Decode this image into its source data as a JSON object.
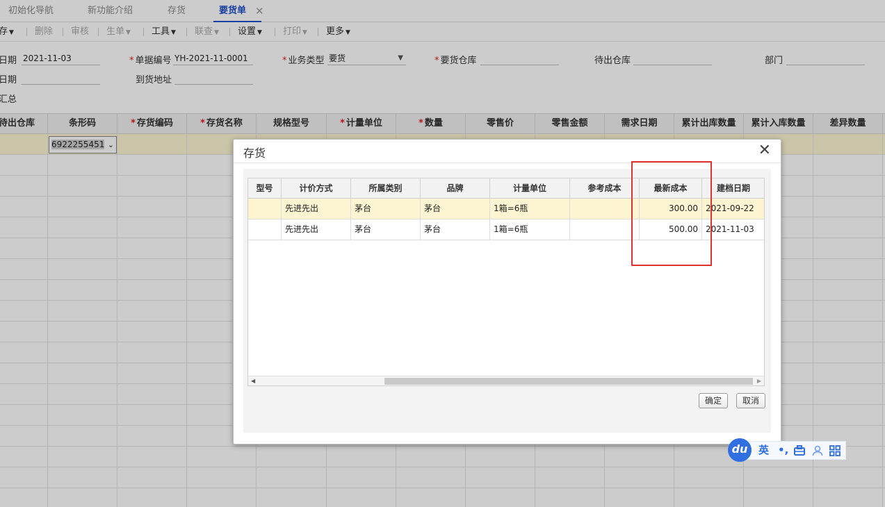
{
  "tabs": [
    {
      "label": "初始化导航",
      "active": false
    },
    {
      "label": "新功能介绍",
      "active": false
    },
    {
      "label": "存货",
      "active": false
    },
    {
      "label": "要货单",
      "active": true
    }
  ],
  "toolbar": {
    "save": "存",
    "delete": "删除",
    "audit": "审核",
    "generate": "生单",
    "tools": "工具",
    "query": "联查",
    "settings": "设置",
    "print": "打印",
    "more": "更多"
  },
  "form": {
    "date_label": "日期",
    "date_value": "2021-11-03",
    "docno_label": "单据编号",
    "docno_value": "YH-2021-11-0001",
    "biztype_label": "业务类型",
    "biztype_value": "要货",
    "req_wh_label": "要货仓库",
    "out_wh_label": "待出仓库",
    "dept_label": "部门",
    "date2_label": "日期",
    "address_label": "到货地址",
    "summary_label": "汇总"
  },
  "grid": {
    "columns": [
      "待出仓库",
      "条形码",
      "存货编码",
      "存货名称",
      "规格型号",
      "计量单位",
      "数量",
      "零售价",
      "零售金额",
      "需求日期",
      "累计出库数量",
      "累计入库数量",
      "差异数量"
    ],
    "barcode_value": "6922255451"
  },
  "dialog": {
    "title": "存货",
    "columns": [
      "型号",
      "计价方式",
      "所属类别",
      "品牌",
      "计量单位",
      "参考成本",
      "最新成本",
      "建档日期"
    ],
    "rows": [
      [
        "",
        "先进先出",
        "茅台",
        "茅台",
        "1箱=6瓶",
        "",
        "300.00",
        "2021-09-22"
      ],
      [
        "",
        "先进先出",
        "茅台",
        "茅台",
        "1箱=6瓶",
        "",
        "500.00",
        "2021-11-03"
      ]
    ],
    "ok": "确定",
    "cancel": "取消"
  },
  "ime": {
    "logo": "du",
    "lang": "英"
  }
}
